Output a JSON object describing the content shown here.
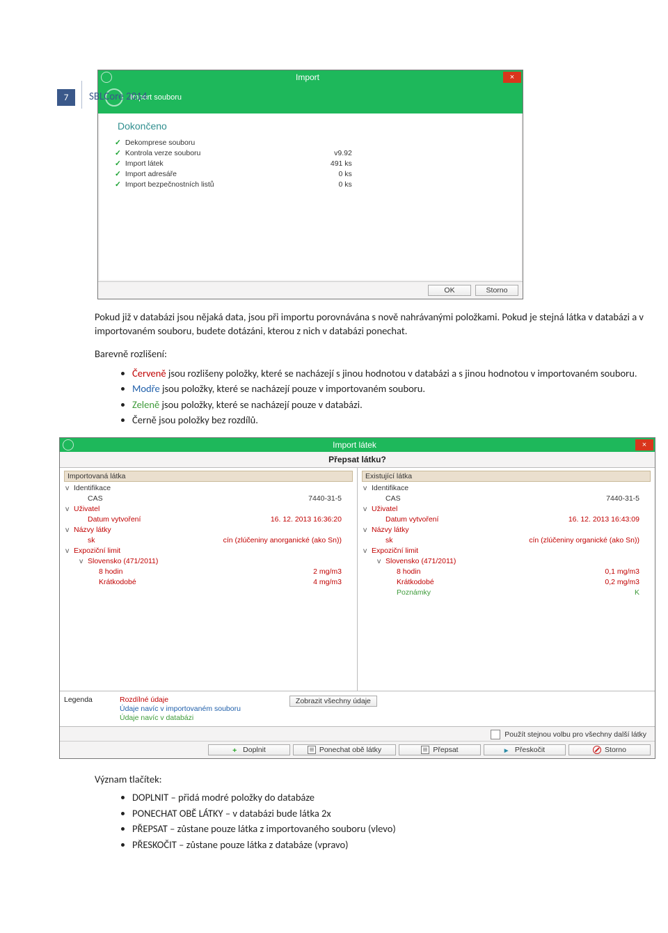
{
  "header": {
    "page_number": "7",
    "doc_title": "SBLCore 2014"
  },
  "screenshot1": {
    "title": "Import",
    "close": "×",
    "subtitle": "Import souboru",
    "done_label": "Dokončeno",
    "rows": [
      {
        "label": "Dekomprese souboru",
        "value": ""
      },
      {
        "label": "Kontrola verze souboru",
        "value": "v9.92"
      },
      {
        "label": "Import látek",
        "value": "491 ks"
      },
      {
        "label": "Import adresáře",
        "value": "0 ks"
      },
      {
        "label": "Import bezpečnostních listů",
        "value": "0 ks"
      }
    ],
    "ok": "OK",
    "cancel": "Storno"
  },
  "text": {
    "p1": "Pokud již v databázi jsou nějaká data, jsou při importu porovnávána s nově nahrávanými položkami. Pokud je stejná látka v databázi a v importovaném souboru, budete dotázáni, kterou z nich v databázi ponechat.",
    "p2": "Barevně rozlišení:",
    "bul1_pre": "Červeně",
    "bul1_rest": " jsou rozlišeny položky, které se nacházejí s jinou hodnotou v databázi a s jinou hodnotou v importovaném souboru.",
    "bul2_pre": "Modře",
    "bul2_rest": " jsou položky, které se nacházejí pouze v importovaném souboru.",
    "bul3_pre": "Zeleně",
    "bul3_rest": " jsou položky, které se nacházejí pouze v databázi.",
    "bul4": "Černě jsou položky bez rozdílů.",
    "p3": "Význam tlačítek:",
    "b1": "DOPLNIT – přidá modré položky do databáze",
    "b2": "PONECHAT OBĚ LÁTKY – v databázi bude látka 2x",
    "b3": "PŘEPSAT – zůstane pouze látka z importovaného souboru (vlevo)",
    "b4": "PŘESKOČIT – zůstane pouze látka z databáze (vpravo)"
  },
  "screenshot2": {
    "title": "Import látek",
    "close": "×",
    "subhead": "Přepsat látku?",
    "left": {
      "header": "Importovaná látka",
      "rows": [
        {
          "k": "Identifikace",
          "v": "",
          "cls": "",
          "ind": "",
          "caret": "v"
        },
        {
          "k": "CAS",
          "v": "7440-31-5",
          "cls": "",
          "ind": "ind1"
        },
        {
          "k": "Uživatel",
          "v": "",
          "cls": "red",
          "ind": "",
          "caret": "v"
        },
        {
          "k": "Datum vytvoření",
          "v": "16. 12. 2013 16:36:20",
          "cls": "red",
          "ind": "ind1"
        },
        {
          "k": "Názvy látky",
          "v": "",
          "cls": "red",
          "ind": "",
          "caret": "v"
        },
        {
          "k": "sk",
          "v": "cín (zlúčeniny anorganické (ako Sn))",
          "cls": "red",
          "ind": "ind1"
        },
        {
          "k": "Expoziční limit",
          "v": "",
          "cls": "red",
          "ind": "",
          "caret": "v"
        },
        {
          "k": "Slovensko (471/2011)",
          "v": "",
          "cls": "red",
          "ind": "ind1",
          "caret": "v"
        },
        {
          "k": "8 hodin",
          "v": "2 mg/m3",
          "cls": "red",
          "ind": "ind2"
        },
        {
          "k": "Krátkodobé",
          "v": "4 mg/m3",
          "cls": "red",
          "ind": "ind2"
        }
      ]
    },
    "right": {
      "header": "Existující látka",
      "rows": [
        {
          "k": "Identifikace",
          "v": "",
          "cls": "",
          "ind": "",
          "caret": "v"
        },
        {
          "k": "CAS",
          "v": "7440-31-5",
          "cls": "",
          "ind": "ind1"
        },
        {
          "k": "Uživatel",
          "v": "",
          "cls": "red",
          "ind": "",
          "caret": "v"
        },
        {
          "k": "Datum vytvoření",
          "v": "16. 12. 2013 16:43:09",
          "cls": "red",
          "ind": "ind1"
        },
        {
          "k": "Názvy látky",
          "v": "",
          "cls": "red",
          "ind": "",
          "caret": "v"
        },
        {
          "k": "sk",
          "v": "cín (zlúčeniny organické (ako Sn))",
          "cls": "red",
          "ind": "ind1"
        },
        {
          "k": "Expoziční limit",
          "v": "",
          "cls": "red",
          "ind": "",
          "caret": "v"
        },
        {
          "k": "Slovensko (471/2011)",
          "v": "",
          "cls": "red",
          "ind": "ind1",
          "caret": "v"
        },
        {
          "k": "8 hodin",
          "v": "0,1 mg/m3",
          "cls": "red",
          "ind": "ind2"
        },
        {
          "k": "Krátkodobé",
          "v": "0,2 mg/m3",
          "cls": "red",
          "ind": "ind2"
        },
        {
          "k": "Poznámky",
          "v": "K",
          "cls": "green",
          "ind": "ind2"
        }
      ]
    },
    "legend": {
      "label": "Legenda",
      "l1": "Rozdílné údaje",
      "l2": "Údaje navíc v importovaném souboru",
      "l3": "Údaje navíc v databázi",
      "button": "Zobrazit všechny údaje"
    },
    "checkbox_label": "Použít stejnou volbu pro všechny další látky",
    "buttons": {
      "doplnit": "Doplnit",
      "ponechat": "Ponechat obě látky",
      "prepsat": "Přepsat",
      "preskocit": "Přeskočit",
      "storno": "Storno"
    }
  }
}
